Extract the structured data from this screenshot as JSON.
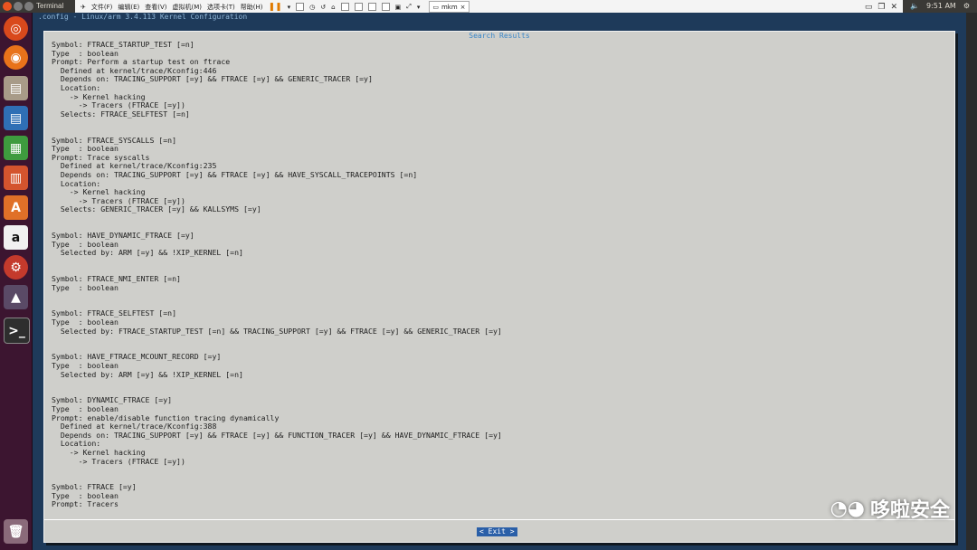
{
  "topbar": {
    "title": "Terminal",
    "clock": "9:51 AM"
  },
  "vmbar": {
    "menus": [
      "文件(F)",
      "编辑(E)",
      "查看(V)",
      "虚拟机(M)",
      "选项卡(T)",
      "帮助(H)"
    ],
    "tab_label": "mkm"
  },
  "terminal": {
    "header": ".config - Linux/arm 3.4.113 Kernel Configuration"
  },
  "dialog": {
    "title": "Search Results",
    "lines": [
      "Symbol: FTRACE_STARTUP_TEST [=n]",
      "Type  : boolean",
      "Prompt: Perform a startup test on ftrace",
      "  Defined at kernel/trace/Kconfig:446",
      "  Depends on: TRACING_SUPPORT [=y] && FTRACE [=y] && GENERIC_TRACER [=y]",
      "  Location:",
      "    -> Kernel hacking",
      "      -> Tracers (FTRACE [=y])",
      "  Selects: FTRACE_SELFTEST [=n]",
      "",
      "",
      "Symbol: FTRACE_SYSCALLS [=n]",
      "Type  : boolean",
      "Prompt: Trace syscalls",
      "  Defined at kernel/trace/Kconfig:235",
      "  Depends on: TRACING_SUPPORT [=y] && FTRACE [=y] && HAVE_SYSCALL_TRACEPOINTS [=n]",
      "  Location:",
      "    -> Kernel hacking",
      "      -> Tracers (FTRACE [=y])",
      "  Selects: GENERIC_TRACER [=y] && KALLSYMS [=y]",
      "",
      "",
      "Symbol: HAVE_DYNAMIC_FTRACE [=y]",
      "Type  : boolean",
      "  Selected by: ARM [=y] && !XIP_KERNEL [=n]",
      "",
      "",
      "Symbol: FTRACE_NMI_ENTER [=n]",
      "Type  : boolean",
      "",
      "",
      "Symbol: FTRACE_SELFTEST [=n]",
      "Type  : boolean",
      "  Selected by: FTRACE_STARTUP_TEST [=n] && TRACING_SUPPORT [=y] && FTRACE [=y] && GENERIC_TRACER [=y]",
      "",
      "",
      "Symbol: HAVE_FTRACE_MCOUNT_RECORD [=y]",
      "Type  : boolean",
      "  Selected by: ARM [=y] && !XIP_KERNEL [=n]",
      "",
      "",
      "Symbol: DYNAMIC_FTRACE [=y]",
      "Type  : boolean",
      "Prompt: enable/disable function tracing dynamically",
      "  Defined at kernel/trace/Kconfig:388",
      "  Depends on: TRACING_SUPPORT [=y] && FTRACE [=y] && FUNCTION_TRACER [=y] && HAVE_DYNAMIC_FTRACE [=y]",
      "  Location:",
      "    -> Kernel hacking",
      "      -> Tracers (FTRACE [=y])",
      "",
      "",
      "Symbol: FTRACE [=y]",
      "Type  : boolean",
      "Prompt: Tracers"
    ],
    "exit_label": "< Exit >"
  },
  "watermark": {
    "text": "哆啦安全"
  }
}
